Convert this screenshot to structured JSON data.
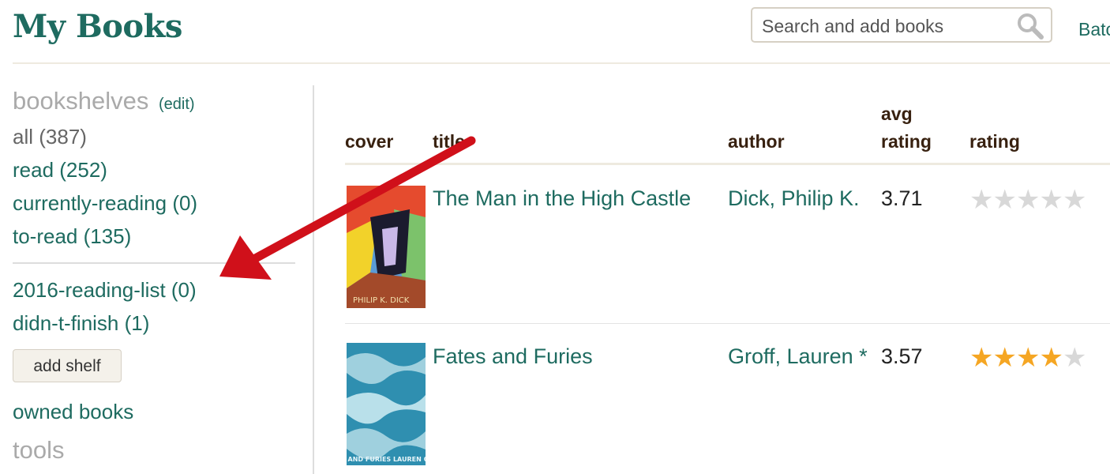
{
  "header": {
    "title": "My Books",
    "search_placeholder": "Search and add books",
    "nav_link": "Batch"
  },
  "sidebar": {
    "heading": "bookshelves",
    "edit_label": "(edit)",
    "default_shelves": [
      {
        "label": "all (387)"
      },
      {
        "label": "read (252)"
      },
      {
        "label": "currently-reading (0)"
      },
      {
        "label": "to-read (135)"
      }
    ],
    "custom_shelves": [
      {
        "label": "2016-reading-list (0)"
      },
      {
        "label": "didn-t-finish (1)"
      }
    ],
    "add_shelf_label": "add shelf",
    "owned_books_label": "owned books",
    "tools_heading": "tools"
  },
  "table": {
    "headers": {
      "cover": "cover",
      "title": "title",
      "author": "author",
      "avg_rating_line1": "avg",
      "avg_rating_line2": "rating",
      "rating": "rating"
    },
    "rows": [
      {
        "title": "The Man in the High Castle",
        "author": "Dick, Philip K.",
        "avg_rating": "3.71",
        "user_rating": 0,
        "cover_text": "PHILIP K. DICK"
      },
      {
        "title": "Fates and Furies",
        "author": "Groff, Lauren *",
        "avg_rating": "3.57",
        "user_rating": 4,
        "cover_text": "FATES AND FURIES LAUREN GROFF"
      }
    ]
  },
  "colors": {
    "brand_green": "#1e6b60",
    "header_brown": "#382110",
    "star_on": "#f5a623",
    "star_off": "#d8d8d8",
    "annotation_arrow": "#d0101a"
  },
  "icons": [
    "search-icon",
    "star-icon",
    "annotation-arrow"
  ]
}
